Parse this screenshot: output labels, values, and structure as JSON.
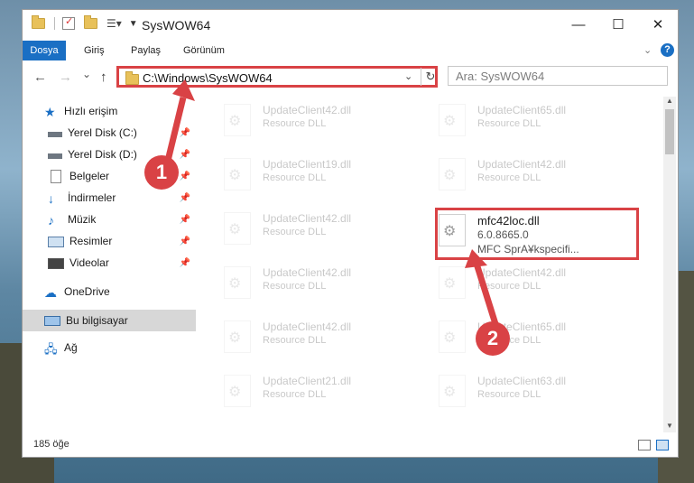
{
  "window": {
    "title": "SysWOW64",
    "controls": {
      "minimize": "—",
      "maximize": "☐",
      "close": "✕"
    }
  },
  "ribbon": {
    "tabs": [
      {
        "label": "Dosya",
        "active": true
      },
      {
        "label": "Giriş"
      },
      {
        "label": "Paylaş"
      },
      {
        "label": "Görünüm"
      }
    ],
    "help": "?"
  },
  "nav": {
    "back": "←",
    "forward": "→",
    "recent": "⌄",
    "up": "↑",
    "address": "C:\\Windows\\SysWOW64",
    "search_placeholder": "Ara: SysWOW64"
  },
  "sidebar": {
    "items": [
      {
        "label": "Hızlı erişim"
      },
      {
        "label": "Yerel Disk (C:)",
        "pinned": true
      },
      {
        "label": "Yerel Disk (D:)",
        "pinned": true
      },
      {
        "label": "Belgeler",
        "pinned": true
      },
      {
        "label": "İndirmeler",
        "pinned": true
      },
      {
        "label": "Müzik",
        "pinned": true
      },
      {
        "label": "Resimler",
        "pinned": true
      },
      {
        "label": "Videolar",
        "pinned": true
      },
      {
        "label": "OneDrive"
      },
      {
        "label": "Bu bilgisayar",
        "selected": true
      },
      {
        "label": "Ağ"
      }
    ]
  },
  "files": {
    "col1": [
      {
        "name": "UpdateClient42.dll",
        "type": "Resource DLL"
      },
      {
        "name": "UpdateClient19.dll",
        "type": "Resource DLL"
      },
      {
        "name": "UpdateClient42.dll",
        "type": "Resource DLL"
      },
      {
        "name": "UpdateClient42.dll",
        "type": "Resource DLL"
      },
      {
        "name": "UpdateClient42.dll",
        "type": "Resource DLL"
      },
      {
        "name": "UpdateClient21.dll",
        "type": "Resource DLL"
      }
    ],
    "col2": [
      {
        "name": "UpdateClient65.dll",
        "type": "Resource DLL"
      },
      {
        "name": "UpdateClient42.dll",
        "type": "Resource DLL"
      },
      {
        "name": "UpdateClient42.dll",
        "type": "Resource DLL"
      },
      {
        "name": "UpdateClient65.dll",
        "type": "Resource DLL"
      },
      {
        "name": "UpdateClient63.dll",
        "type": "Resource DLL"
      }
    ],
    "highlighted": {
      "name": "mfc42loc.dll",
      "version": "6.0.8665.0",
      "description": "MFC SprA¥kspecifi..."
    }
  },
  "status": {
    "count": "185 öğe"
  },
  "markers": {
    "one": "1",
    "two": "2"
  },
  "colors": {
    "accent": "#1a6fc4",
    "highlight": "#d94245"
  }
}
